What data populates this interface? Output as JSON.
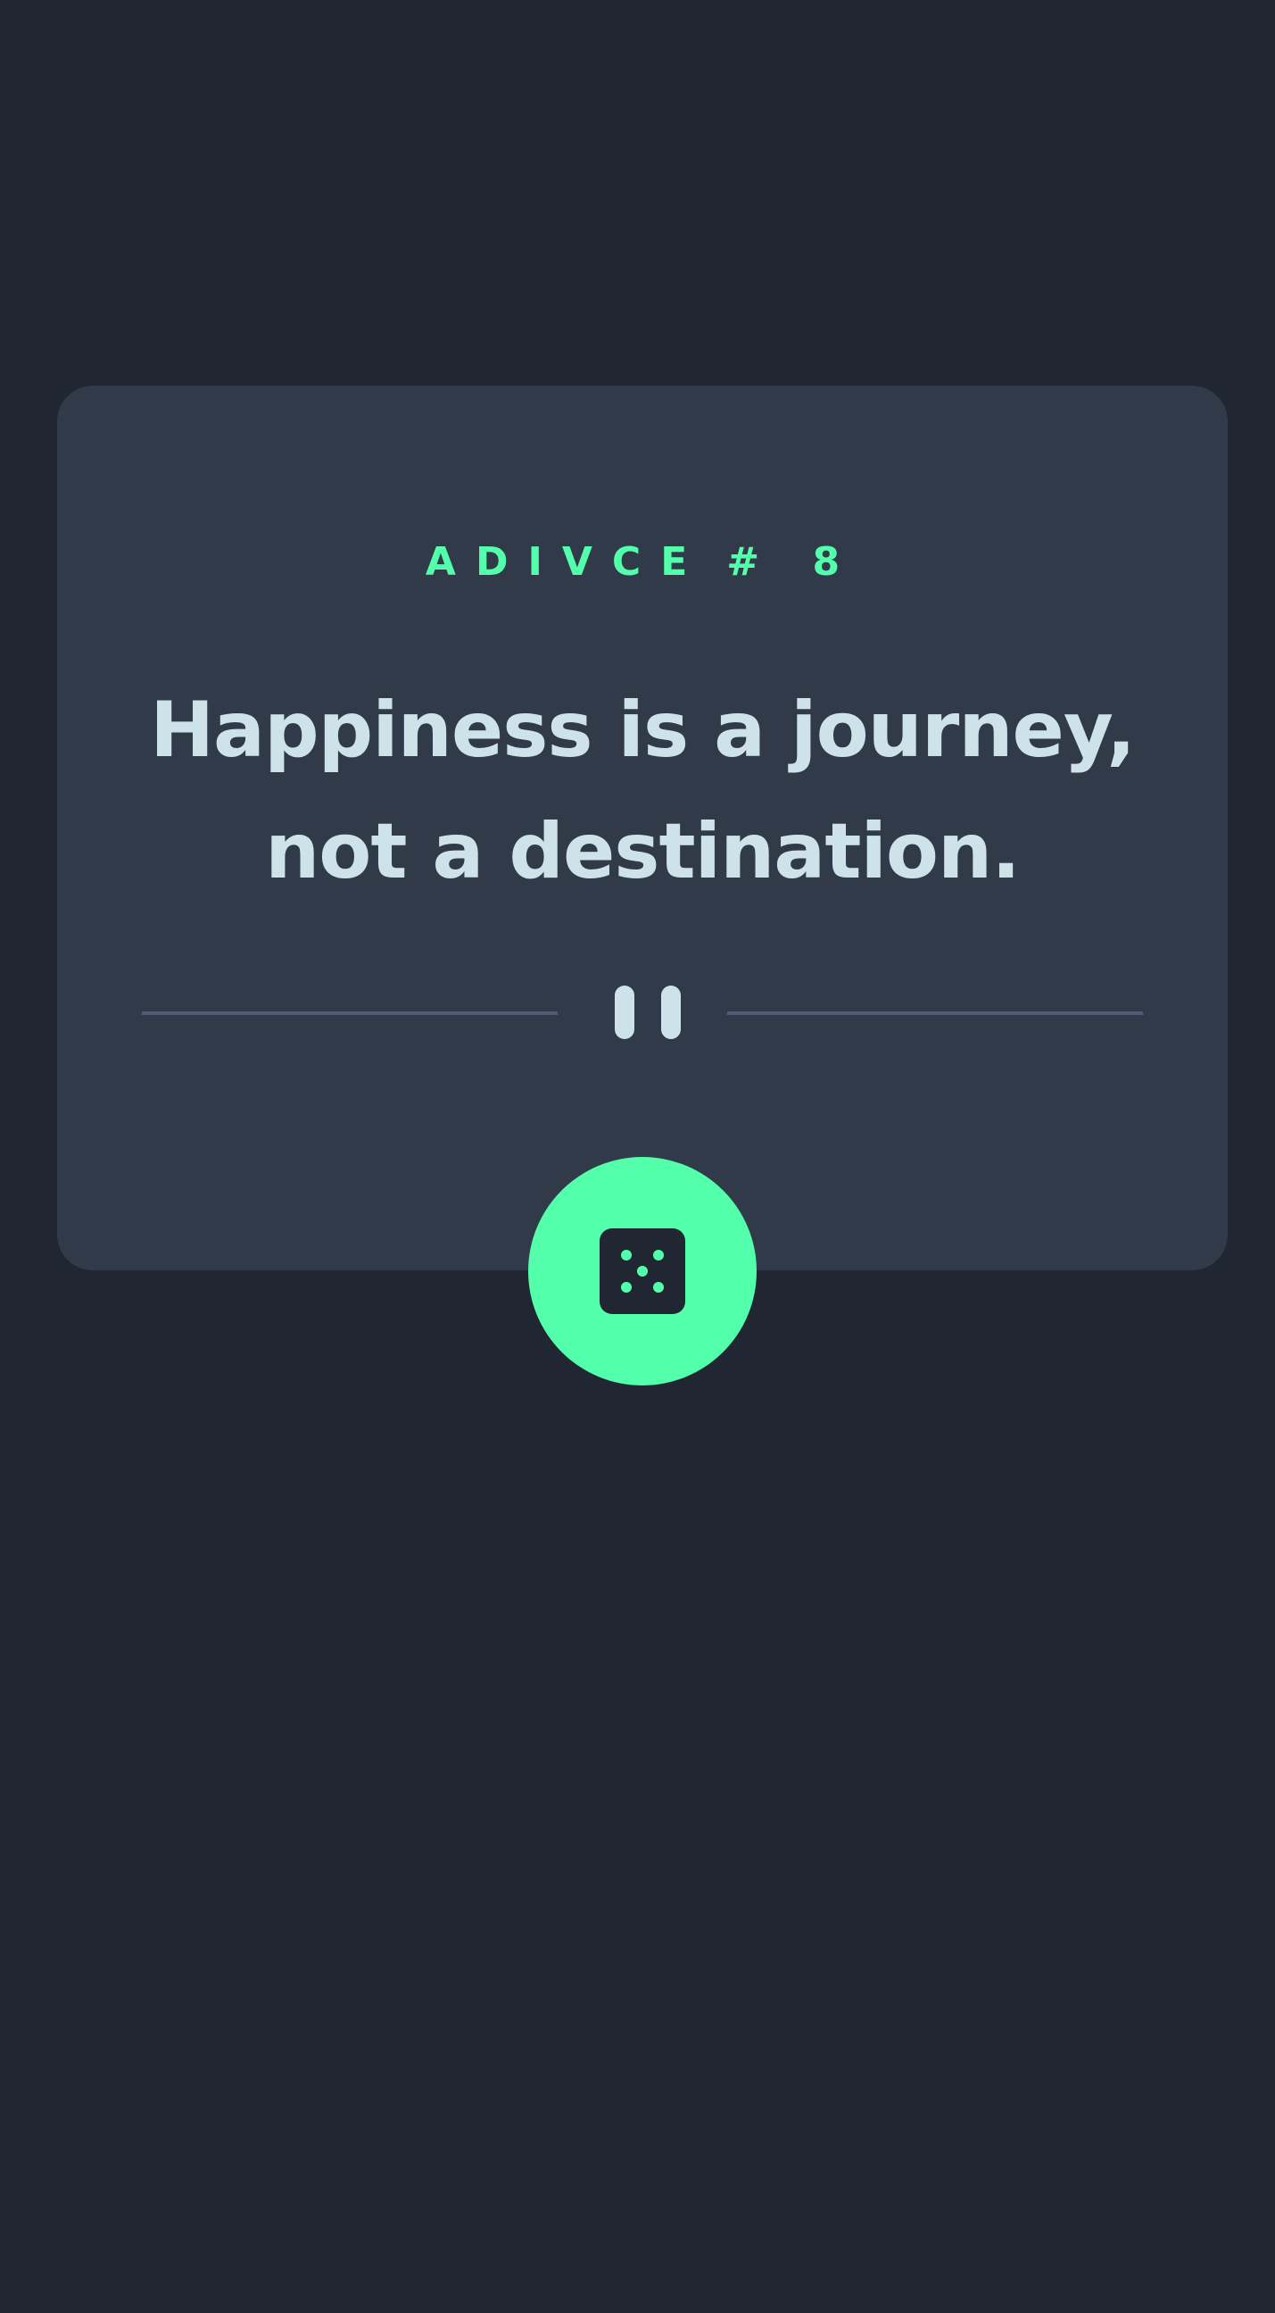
{
  "advice": {
    "label_prefix": "ADIVCE",
    "label_number": "# 8",
    "quote_line1": "Happiness is a journey,",
    "quote_line2": "not a destination."
  },
  "icons": {
    "divider": "pause-icon",
    "button": "dice-icon"
  },
  "colors": {
    "background": "#202632",
    "card": "#313A49",
    "accent": "#53FFAA",
    "text": "#CEE3E9",
    "divider_line": "#4F5D74"
  }
}
